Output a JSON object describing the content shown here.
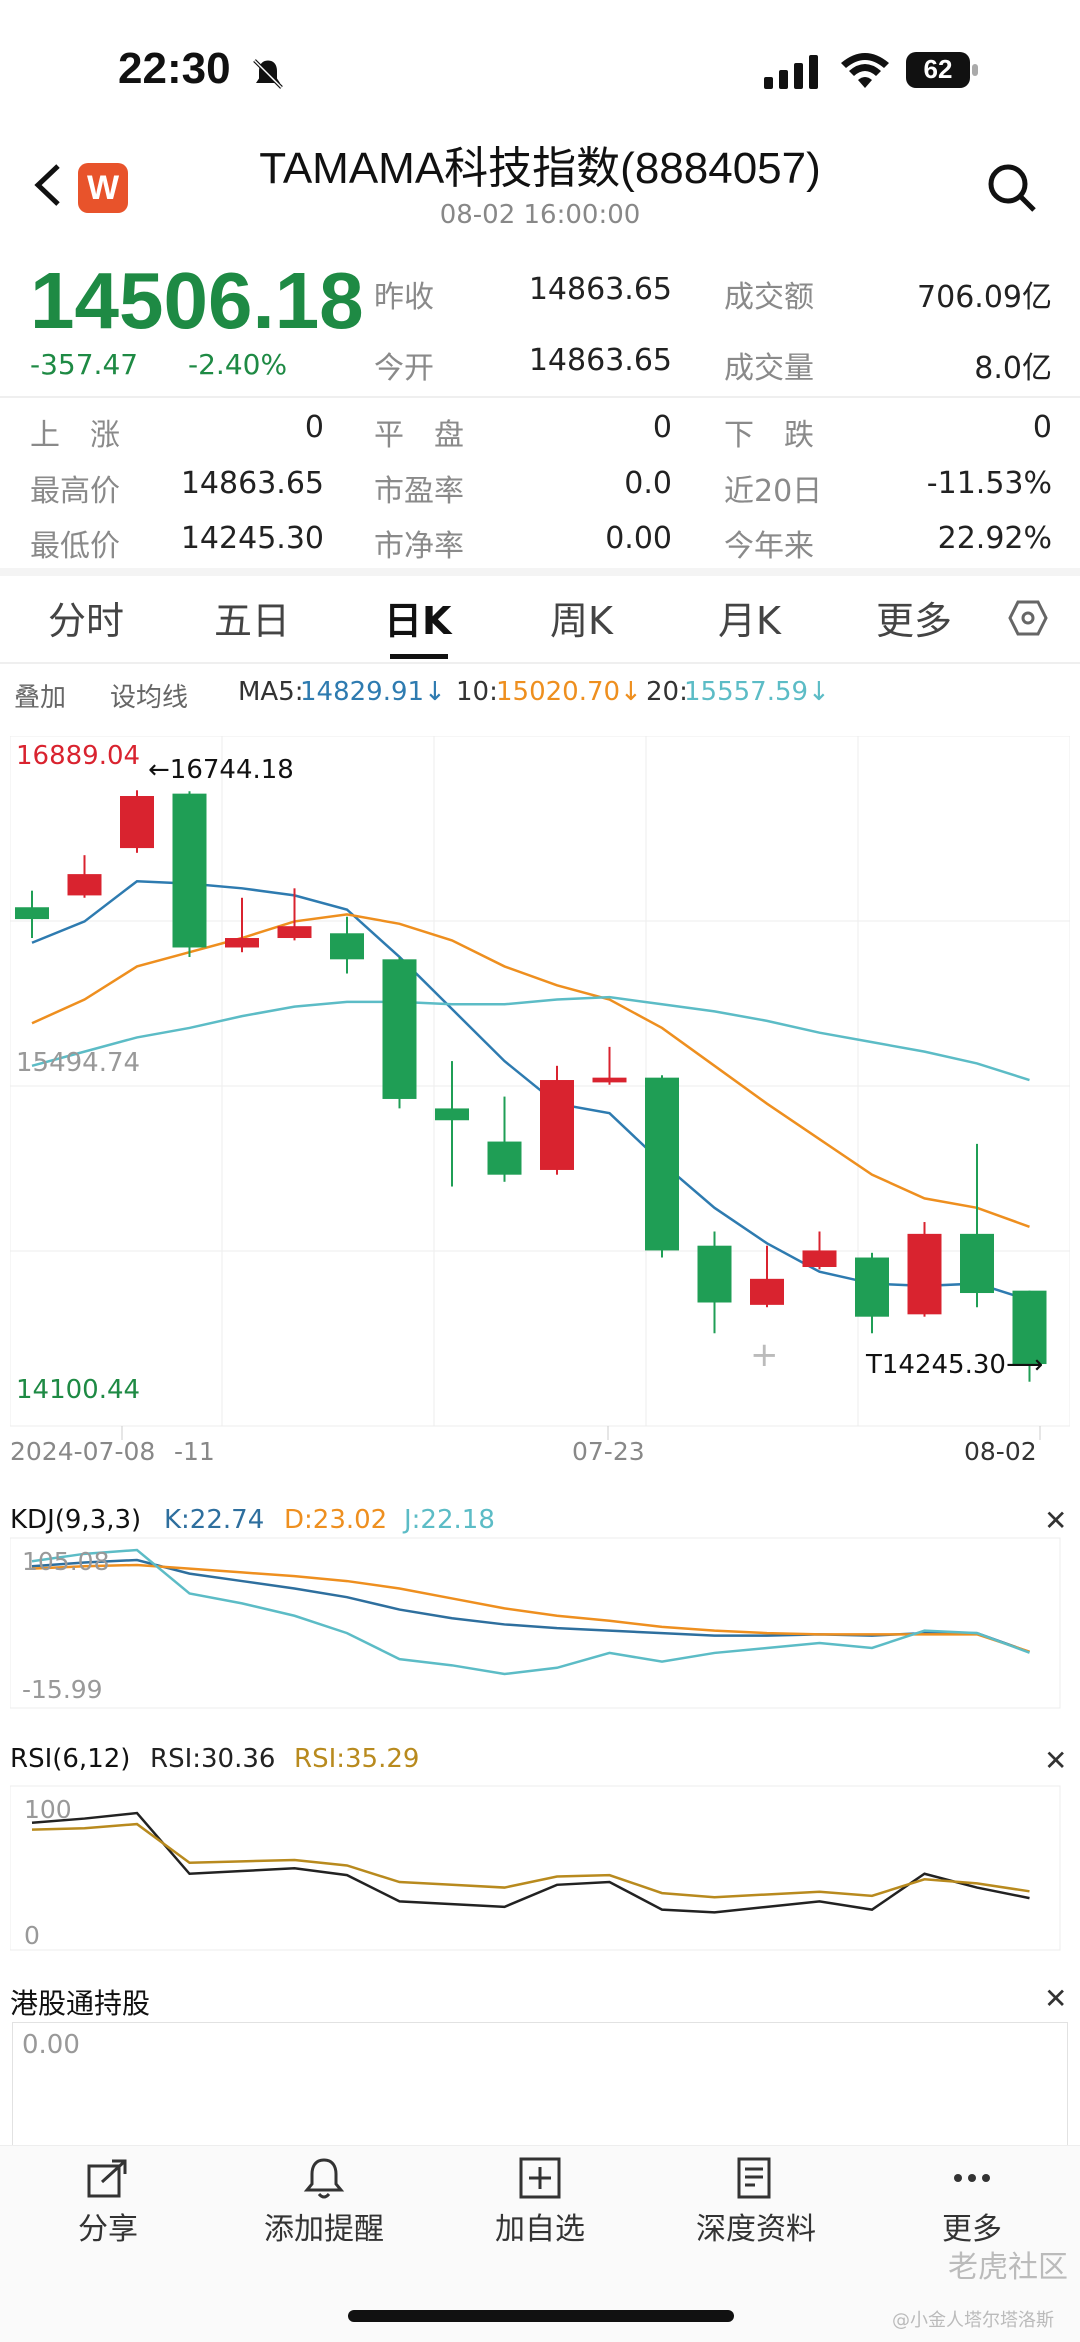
{
  "status": {
    "time": "22:30",
    "battery": "62"
  },
  "header": {
    "title": "TAMAMA科技指数(8884057)",
    "subtitle": "08-02 16:00:00",
    "logo": "W"
  },
  "quote": {
    "price": "14506.18",
    "change": "-357.47",
    "change_pct": "-2.40%",
    "prev_close_label": "昨收",
    "prev_close": "14863.65",
    "open_label": "今开",
    "open": "14863.65",
    "turnover_label": "成交额",
    "turnover": "706.09亿",
    "volume_label": "成交量",
    "volume": "8.0亿",
    "up_label": "上　涨",
    "up": "0",
    "flat_label": "平　盘",
    "flat": "0",
    "down_label": "下　跌",
    "down": "0",
    "high_label": "最高价",
    "high": "14863.65",
    "pe_label": "市盈率",
    "pe": "0.0",
    "d20_label": "近20日",
    "d20": "-11.53%",
    "low_label": "最低价",
    "low": "14245.30",
    "pb_label": "市净率",
    "pb": "0.00",
    "ytd_label": "今年来",
    "ytd": "22.92%"
  },
  "tabs": [
    "分时",
    "五日",
    "日K",
    "周K",
    "月K",
    "更多"
  ],
  "ma_row": {
    "overlay": "叠加",
    "set_ma": "设均线",
    "ma5_label": "MA5:",
    "ma5": "14829.91↓",
    "ma10_label": "10:",
    "ma10": "15020.70↓",
    "ma20_label": "20:",
    "ma20": "15557.59↓"
  },
  "colors": {
    "up": "#d9232f",
    "down": "#1f9e55",
    "ma5": "#2e7bb0",
    "ma10": "#ee8f1f",
    "ma20": "#5cbcc6",
    "k": "#2e6f9e",
    "d": "#ee8f1f",
    "j": "#5cbcc6",
    "rsi6": "#222222",
    "rsi12": "#b88a1e"
  },
  "chart_data": [
    {
      "type": "candlestick",
      "title": "日K",
      "y_labels": [
        "16889.04",
        "15494.74",
        "14100.44"
      ],
      "ylim": [
        14100.44,
        16889.04
      ],
      "x_labels": [
        "2024-07-08",
        "-11",
        "07-23",
        "08-02"
      ],
      "max_marker": "16744.18",
      "min_marker": "14245.30",
      "candles": [
        {
          "o": 16250,
          "c": 16200,
          "h": 16320,
          "l": 16120
        },
        {
          "o": 16300,
          "c": 16390,
          "h": 16470,
          "l": 16290
        },
        {
          "o": 16500,
          "c": 16720,
          "h": 16744.18,
          "l": 16480
        },
        {
          "o": 16730,
          "c": 16080,
          "h": 16740,
          "l": 16040
        },
        {
          "o": 16080,
          "c": 16120,
          "h": 16290,
          "l": 16060
        },
        {
          "o": 16120,
          "c": 16170,
          "h": 16330,
          "l": 16110
        },
        {
          "o": 16140,
          "c": 16030,
          "h": 16210,
          "l": 15970
        },
        {
          "o": 16030,
          "c": 15440,
          "h": 16040,
          "l": 15400
        },
        {
          "o": 15400,
          "c": 15350,
          "h": 15600,
          "l": 15070
        },
        {
          "o": 15260,
          "c": 15120,
          "h": 15450,
          "l": 15090
        },
        {
          "o": 15140,
          "c": 15520,
          "h": 15580,
          "l": 15120
        },
        {
          "o": 15510,
          "c": 15530,
          "h": 15660,
          "l": 15500
        },
        {
          "o": 15530,
          "c": 14800,
          "h": 15540,
          "l": 14770
        },
        {
          "o": 14820,
          "c": 14580,
          "h": 14880,
          "l": 14450
        },
        {
          "o": 14570,
          "c": 14680,
          "h": 14820,
          "l": 14560
        },
        {
          "o": 14730,
          "c": 14800,
          "h": 14880,
          "l": 14720
        },
        {
          "o": 14770,
          "c": 14520,
          "h": 14790,
          "l": 14450
        },
        {
          "o": 14530,
          "c": 14870,
          "h": 14920,
          "l": 14520
        },
        {
          "o": 14870,
          "c": 14620,
          "h": 15250,
          "l": 14560
        },
        {
          "o": 14630,
          "c": 14320,
          "h": 14630,
          "l": 14245.3
        }
      ],
      "series": [
        {
          "name": "MA5",
          "values": [
            16100,
            16190,
            16360,
            16350,
            16330,
            16300,
            16240,
            16040,
            15820,
            15600,
            15420,
            15380,
            15170,
            14980,
            14830,
            14710,
            14660,
            14650,
            14660,
            14590
          ]
        },
        {
          "name": "10",
          "values": [
            15760,
            15860,
            16000,
            16060,
            16120,
            16190,
            16220,
            16180,
            16110,
            16000,
            15920,
            15860,
            15740,
            15580,
            15420,
            15270,
            15120,
            15020,
            14980,
            14900
          ]
        },
        {
          "name": "20",
          "values": [
            15580,
            15640,
            15700,
            15740,
            15790,
            15830,
            15850,
            15850,
            15840,
            15840,
            15860,
            15870,
            15840,
            15810,
            15770,
            15720,
            15680,
            15640,
            15590,
            15520
          ]
        }
      ]
    },
    {
      "type": "line",
      "title": "KDJ(9,3,3)",
      "y_labels": [
        "105.08",
        "-15.99"
      ],
      "ylim": [
        -15.99,
        105.08
      ],
      "legend": {
        "k": "K:22.74",
        "d": "D:23.02",
        "j": "J:22.18"
      },
      "series": [
        {
          "name": "K",
          "values": [
            92,
            95,
            97,
            86,
            80,
            74,
            67,
            57,
            50,
            45,
            42,
            40,
            38,
            36,
            36,
            37,
            36,
            38,
            38,
            22.74
          ]
        },
        {
          "name": "D",
          "values": [
            90,
            92,
            93,
            90,
            87,
            84,
            80,
            74,
            66,
            58,
            52,
            48,
            43,
            40,
            38,
            37,
            37,
            37,
            37,
            23.02
          ]
        },
        {
          "name": "J",
          "values": [
            96,
            102,
            105.08,
            70,
            62,
            52,
            38,
            17,
            12,
            5,
            10,
            22,
            15,
            22,
            26,
            30,
            26,
            40,
            38,
            22.18
          ]
        }
      ]
    },
    {
      "type": "line",
      "title": "RSI(6,12)",
      "y_labels": [
        "100",
        "0"
      ],
      "ylim": [
        0,
        100
      ],
      "legend": {
        "rsi6": "RSI:30.36",
        "rsi12": "RSI:35.29"
      },
      "series": [
        {
          "name": "RSI6",
          "values": [
            85,
            88,
            92,
            48,
            50,
            52,
            47,
            28,
            26,
            24,
            40,
            42,
            22,
            20,
            24,
            28,
            22,
            48,
            38,
            30.36
          ]
        },
        {
          "name": "RSI12",
          "values": [
            80,
            81,
            84,
            56,
            57,
            58,
            54,
            42,
            40,
            38,
            46,
            47,
            34,
            31,
            33,
            35,
            32,
            44,
            41,
            35.29
          ]
        }
      ]
    }
  ],
  "hk_connect": {
    "title": "港股通持股",
    "value": "0.00"
  },
  "bottom_nav": [
    "分享",
    "添加提醒",
    "加自选",
    "深度资料",
    "更多"
  ],
  "watermark": {
    "brand": "老虎社区",
    "user": "@小金人塔尔塔洛斯"
  }
}
